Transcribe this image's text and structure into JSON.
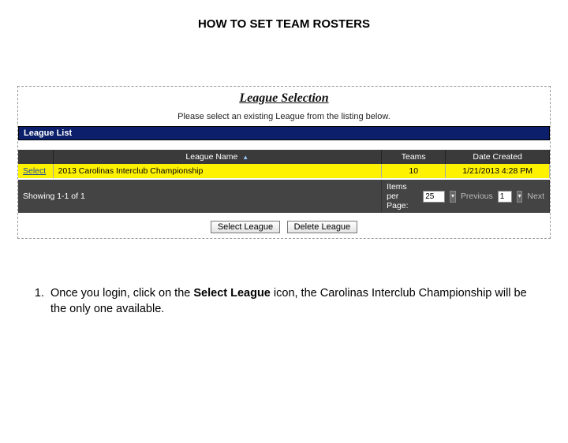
{
  "title": "HOW TO SET TEAM ROSTERS",
  "panel": {
    "heading": "League Selection",
    "subtext": "Please select an existing League from the listing below.",
    "section_label": "League List",
    "columns": {
      "name": "League Name",
      "teams": "Teams",
      "date": "Date Created"
    },
    "row": {
      "select": "Select",
      "name": "2013 Carolinas Interclub Championship",
      "teams": "10",
      "date": "1/21/2013 4:28 PM"
    },
    "pager": {
      "showing": "Showing 1-1 of 1",
      "items_label": "Items per Page:",
      "items_value": "25",
      "prev": "Previous",
      "page_value": "1",
      "next": "Next"
    },
    "buttons": {
      "select": "Select League",
      "delete": "Delete League"
    }
  },
  "instruction": {
    "text_prefix": "Once you login, click on the ",
    "bold": "Select League",
    "text_suffix": " icon, the Carolinas Interclub Championship will be the only one available."
  }
}
